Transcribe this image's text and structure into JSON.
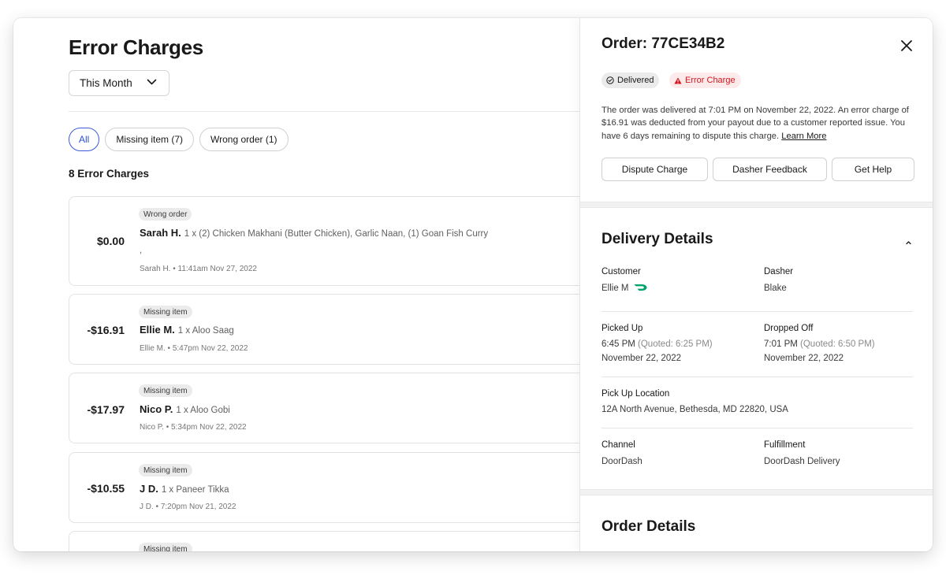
{
  "page": {
    "title": "Error Charges",
    "period": "This Month",
    "filters": [
      {
        "label": "All",
        "active": true
      },
      {
        "label": "Missing item (7)",
        "active": false
      },
      {
        "label": "Wrong order (1)",
        "active": false
      }
    ],
    "count_label": "8 Error Charges"
  },
  "charges": [
    {
      "amount": "$0.00",
      "tag": "Wrong order",
      "customer": "Sarah H.",
      "items": "1 x (2) Chicken Makhani (Butter Chicken), Garlic Naan, (1) Goan Fish Curry",
      "extra": ",",
      "meta": "Sarah H. • 11:41am Nov 27, 2022"
    },
    {
      "amount": "-$16.91",
      "tag": "Missing item",
      "customer": "Ellie M.",
      "items": "1 x Aloo Saag",
      "meta": "Ellie M. • 5:47pm Nov 22, 2022"
    },
    {
      "amount": "-$17.97",
      "tag": "Missing item",
      "customer": "Nico P.",
      "items": "1 x Aloo Gobi",
      "meta": "Nico P. • 5:34pm Nov 22, 2022"
    },
    {
      "amount": "-$10.55",
      "tag": "Missing item",
      "customer": "J D.",
      "items": "1 x Paneer Tikka",
      "meta": "J D. • 7:20pm Nov 21, 2022"
    },
    {
      "tag": "Missing item"
    }
  ],
  "detail": {
    "title": "Order: 77CE34B2",
    "status_badge": "Delivered",
    "error_badge": "Error Charge",
    "description": "The order was delivered at 7:01 PM on November 22, 2022. An error charge of $16.91 was deducted from your payout due to a customer reported issue. You have 6 days remaining to dispute this charge.",
    "learn_more": "Learn More",
    "buttons": {
      "dispute": "Dispute Charge",
      "feedback": "Dasher Feedback",
      "help": "Get Help"
    },
    "delivery": {
      "title": "Delivery Details",
      "customer_label": "Customer",
      "customer": "Ellie M",
      "dasher_label": "Dasher",
      "dasher": "Blake",
      "picked_label": "Picked Up",
      "picked_time": "6:45 PM",
      "picked_quoted": "(Quoted: 6:25 PM)",
      "picked_date": "November 22, 2022",
      "dropped_label": "Dropped Off",
      "dropped_time": "7:01 PM",
      "dropped_quoted": "(Quoted: 6:50 PM)",
      "dropped_date": "November 22, 2022",
      "location_label": "Pick Up Location",
      "location": "12A North Avenue, Bethesda, MD 22820, USA",
      "channel_label": "Channel",
      "channel": "DoorDash",
      "fulfillment_label": "Fulfillment",
      "fulfillment": "DoorDash Delivery"
    },
    "order_details_title": "Order Details"
  },
  "colors": {
    "accent": "#3b5bdb",
    "error": "#d3141e",
    "dash_logo": "#00a36c"
  }
}
